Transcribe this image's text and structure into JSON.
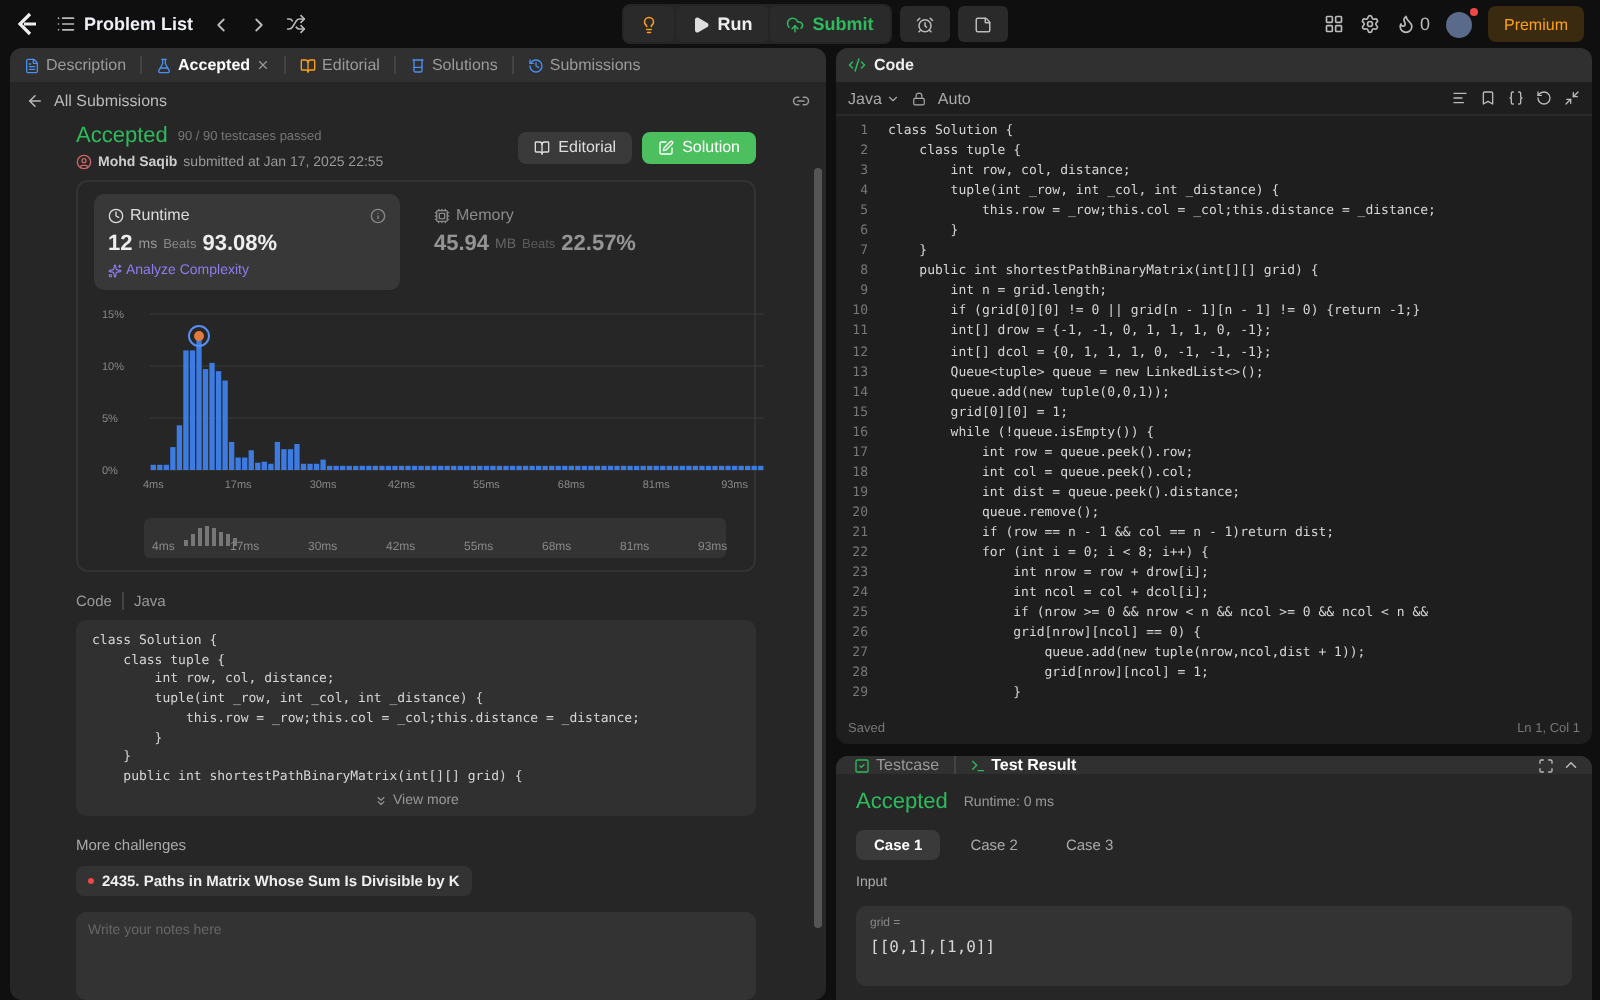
{
  "topbar": {
    "title": "Problem List",
    "run": "Run",
    "submit": "Submit",
    "streak": "0",
    "premium": "Premium"
  },
  "left_tabs": [
    {
      "label": "Description",
      "selected": false,
      "closable": false
    },
    {
      "label": "Accepted",
      "selected": true,
      "closable": true
    },
    {
      "label": "Editorial",
      "selected": false,
      "closable": false
    },
    {
      "label": "Solutions",
      "selected": false,
      "closable": false
    },
    {
      "label": "Submissions",
      "selected": false,
      "closable": false
    }
  ],
  "back": "All Submissions",
  "submission": {
    "status": "Accepted",
    "passed": "90 / 90 testcases passed",
    "author": "Mohd Saqib",
    "submitted": "submitted at Jan 17, 2025 22:55",
    "editorial_button": "Editorial",
    "solution_button": "Solution"
  },
  "stats": [
    {
      "label": "Runtime",
      "value": "12",
      "unit": "ms",
      "beats_label": "Beats",
      "beats": "93.08%",
      "selected": true,
      "link": "Analyze Complexity"
    },
    {
      "label": "Memory",
      "value": "45.94",
      "unit": "MB",
      "beats_label": "Beats",
      "beats": "22.57%",
      "selected": false
    }
  ],
  "chart_data": {
    "type": "bar",
    "ylim": [
      0,
      15
    ],
    "yticks": [
      {
        "value": 0,
        "label": "0%"
      },
      {
        "value": 5,
        "label": "5%"
      },
      {
        "value": 10,
        "label": "10%"
      },
      {
        "value": 15,
        "label": "15%"
      }
    ],
    "x": [
      4,
      5,
      6,
      7,
      8,
      9,
      10,
      11,
      12,
      13,
      14,
      15,
      16,
      17,
      18,
      19,
      20,
      21,
      22,
      23,
      24,
      25,
      26,
      27,
      28,
      29,
      30,
      31,
      32,
      33,
      34,
      35,
      36,
      37,
      38,
      39,
      40,
      41,
      42,
      43,
      44,
      45,
      46,
      47,
      48,
      49,
      50,
      51,
      52,
      53,
      54,
      55,
      56,
      57,
      58,
      59,
      60,
      61,
      62,
      63,
      64,
      65,
      66,
      67,
      68,
      69,
      70,
      71,
      72,
      73,
      74,
      75,
      76,
      77,
      78,
      79,
      80,
      81,
      82,
      83,
      84,
      85,
      86,
      87,
      88,
      89,
      90,
      91,
      92,
      93,
      94,
      95,
      96,
      97
    ],
    "xlim": [
      3.5,
      97.5
    ],
    "values": [
      0.5,
      0.5,
      0.5,
      2.2,
      4.3,
      11.5,
      11.5,
      12.5,
      9.7,
      10.3,
      9.5,
      8.6,
      2.7,
      1.2,
      1.2,
      1.9,
      0.7,
      0.8,
      0.6,
      2.7,
      2,
      2,
      2.5,
      0.6,
      0.6,
      0.6,
      1,
      0.4,
      0.4,
      0.4,
      0.4,
      0.4,
      0.4,
      0.4,
      0.4,
      0.4,
      0.4,
      0.4,
      0.4,
      0.4,
      0.4,
      0.4,
      0.4,
      0.4,
      0.4,
      0.4,
      0.4,
      0.4,
      0.4,
      0.4,
      0.4,
      0.4,
      0.4,
      0.4,
      0.4,
      0.4,
      0.4,
      0.4,
      0.4,
      0.4,
      0.4,
      0.4,
      0.4,
      0.4,
      0.4,
      0.4,
      0.4,
      0.4,
      0.4,
      0.4,
      0.4,
      0.4,
      0.4,
      0.4,
      0.4,
      0.4,
      0.4,
      0.4,
      0.4,
      0.4,
      0.4,
      0.4,
      0.4,
      0.4,
      0.4,
      0.4,
      0.4,
      0.4,
      0.4,
      0.4,
      0.4,
      0.4,
      0.4,
      0.4
    ],
    "xticks": [
      {
        "value": 4,
        "label": "4ms"
      },
      {
        "value": 17,
        "label": "17ms"
      },
      {
        "value": 30,
        "label": "30ms"
      },
      {
        "value": 42,
        "label": "42ms"
      },
      {
        "value": 55,
        "label": "55ms"
      },
      {
        "value": 68,
        "label": "68ms"
      },
      {
        "value": 81,
        "label": "81ms"
      },
      {
        "value": 93,
        "label": "93ms"
      }
    ]
  },
  "overview_labels": [
    "4ms",
    "17ms",
    "30ms",
    "42ms",
    "55ms",
    "68ms",
    "81ms",
    "93ms"
  ],
  "code_header": {
    "label": "Code",
    "language": "Java"
  },
  "code_preview": [
    "class Solution {",
    "    class tuple {",
    "        int row, col, distance;",
    "        tuple(int _row, int _col, int _distance) {",
    "            this.row = _row;this.col = _col;this.distance = _distance;",
    "        }",
    "    }",
    "    public int shortestPathBinaryMatrix(int[][] grid) {"
  ],
  "view_more": "View more",
  "more_challenges": {
    "title": "More challenges",
    "items": [
      {
        "label": "2435. Paths in Matrix Whose Sum Is Divisible by K",
        "color": "#ef4743"
      }
    ]
  },
  "notes": {
    "placeholder": "Write your notes here"
  },
  "editor": {
    "title": "Code",
    "language": "Java",
    "mode": "Auto",
    "status": "Saved",
    "cursor": "Ln 1, Col 1",
    "lines": [
      {
        "n": "1",
        "code": "class Solution {"
      },
      {
        "n": "2",
        "code": "    class tuple {"
      },
      {
        "n": "3",
        "code": "        int row, col, distance;"
      },
      {
        "n": "4",
        "code": "        tuple(int _row, int _col, int _distance) {"
      },
      {
        "n": "5",
        "code": "            this.row = _row;this.col = _col;this.distance = _distance;"
      },
      {
        "n": "6",
        "code": "        }"
      },
      {
        "n": "7",
        "code": "    }"
      },
      {
        "n": "8",
        "code": "    public int shortestPathBinaryMatrix(int[][] grid) {"
      },
      {
        "n": "9",
        "code": "        int n = grid.length;"
      },
      {
        "n": "10",
        "code": "        if (grid[0][0] != 0 || grid[n - 1][n - 1] != 0) {return -1;}"
      },
      {
        "n": "11",
        "code": "        int[] drow = {-1, -1, 0, 1, 1, 1, 0, -1};"
      },
      {
        "n": "12",
        "code": "        int[] dcol = {0, 1, 1, 1, 0, -1, -1, -1};"
      },
      {
        "n": "13",
        "code": "        Queue<tuple> queue = new LinkedList<>();"
      },
      {
        "n": "14",
        "code": "        queue.add(new tuple(0,0,1));"
      },
      {
        "n": "15",
        "code": "        grid[0][0] = 1;"
      },
      {
        "n": "16",
        "code": "        while (!queue.isEmpty()) {"
      },
      {
        "n": "17",
        "code": "            int row = queue.peek().row;"
      },
      {
        "n": "18",
        "code": "            int col = queue.peek().col;"
      },
      {
        "n": "19",
        "code": "            int dist = queue.peek().distance;"
      },
      {
        "n": "20",
        "code": "            queue.remove();"
      },
      {
        "n": "21",
        "code": "            if (row == n - 1 && col == n - 1)return dist;"
      },
      {
        "n": "22",
        "code": "            for (int i = 0; i < 8; i++) {"
      },
      {
        "n": "23",
        "code": "                int nrow = row + drow[i];"
      },
      {
        "n": "24",
        "code": "                int ncol = col + dcol[i];"
      },
      {
        "n": "25",
        "code": "                if (nrow >= 0 && nrow < n && ncol >= 0 && ncol < n &&"
      },
      {
        "n": "26",
        "code": "                grid[nrow][ncol] == 0) {"
      },
      {
        "n": "27",
        "code": "                    queue.add(new tuple(nrow,ncol,dist + 1));"
      },
      {
        "n": "28",
        "code": "                    grid[nrow][ncol] = 1;"
      },
      {
        "n": "29",
        "code": "                }"
      }
    ]
  },
  "test_tabs": [
    {
      "label": "Testcase",
      "selected": false
    },
    {
      "label": "Test Result",
      "selected": true
    }
  ],
  "result": {
    "status": "Accepted",
    "runtime": "Runtime: 0 ms"
  },
  "cases": [
    {
      "label": "Case 1",
      "selected": true
    },
    {
      "label": "Case 2",
      "selected": false
    },
    {
      "label": "Case 3",
      "selected": false
    }
  ],
  "input": {
    "label": "Input",
    "name": "grid =",
    "value": "[[0,1],[1,0]]"
  }
}
